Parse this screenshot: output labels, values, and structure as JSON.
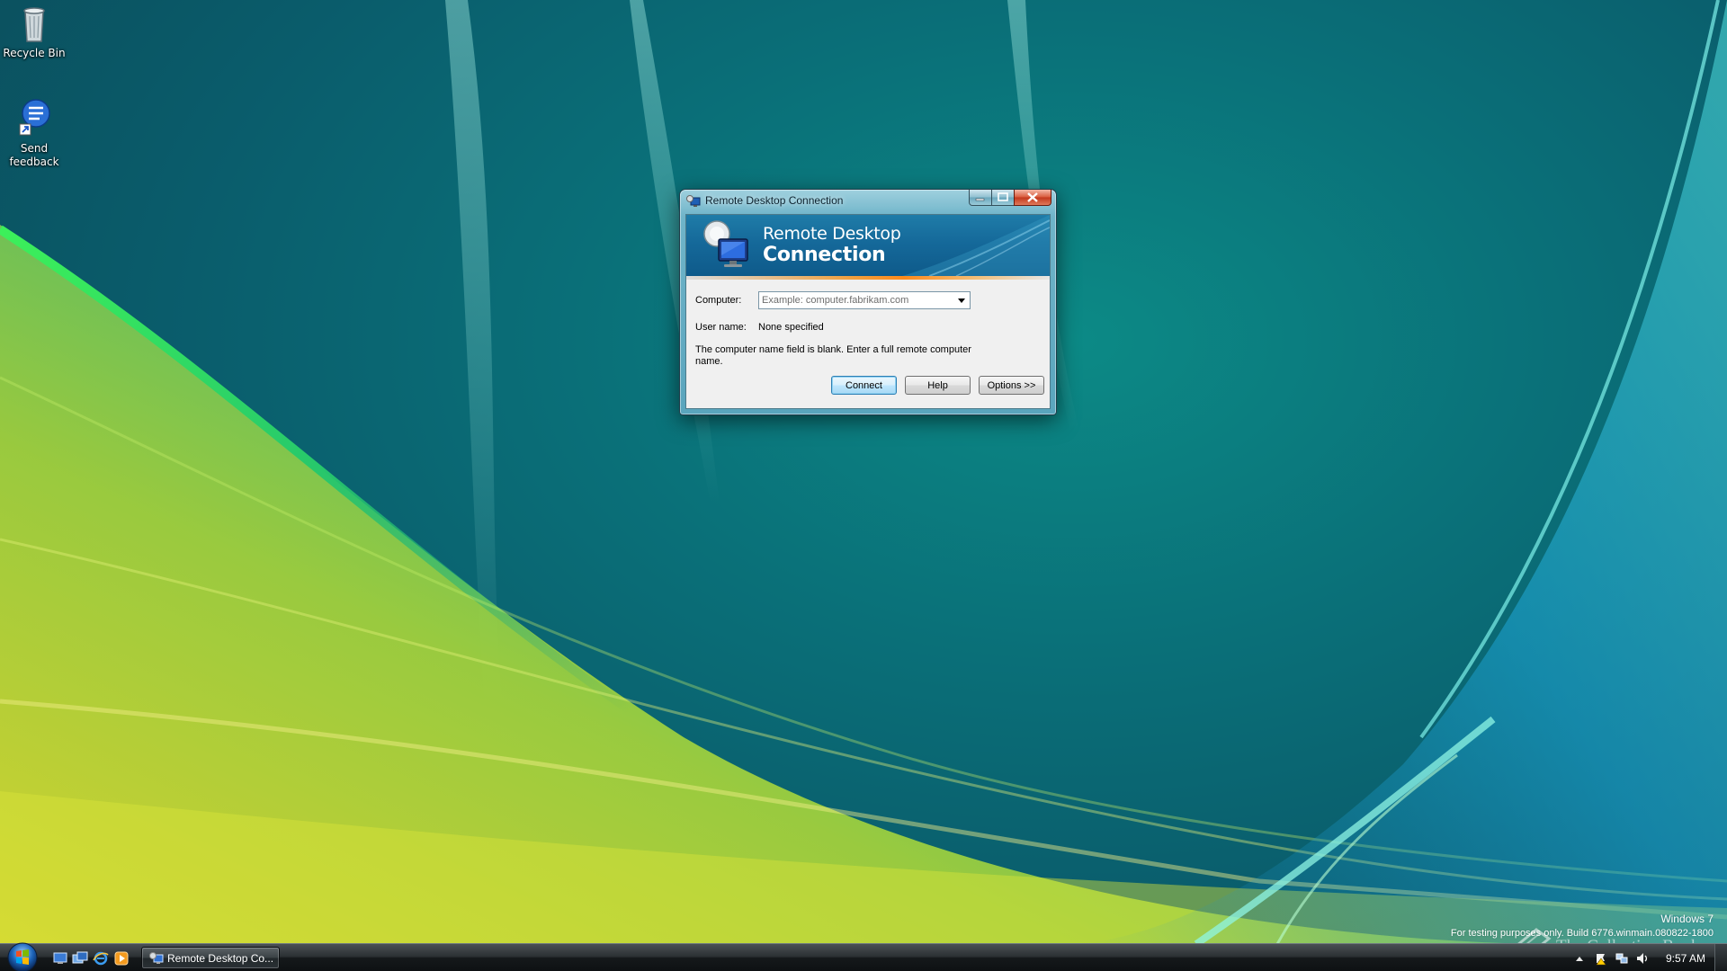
{
  "desktop": {
    "icons": [
      {
        "label": "Recycle Bin",
        "icon": "recycle-bin-icon"
      },
      {
        "label": "Send feedback",
        "icon": "feedback-icon"
      }
    ]
  },
  "dialog": {
    "title": "Remote Desktop Connection",
    "banner": {
      "line1": "Remote Desktop",
      "line2": "Connection"
    },
    "computer_label": "Computer:",
    "computer_value": "",
    "computer_placeholder": "Example: computer.fabrikam.com",
    "username_label": "User name:",
    "username_value": "None specified",
    "message": "The computer name field is blank. Enter a full remote computer name.",
    "buttons": {
      "connect": "Connect",
      "help": "Help",
      "options": "Options >>"
    }
  },
  "watermark": {
    "os": "Windows 7",
    "build": "For testing purposes only. Build 6776.winmain.080822-1800",
    "collection": "The Collection Book"
  },
  "taskbar": {
    "task_button_label": "Remote Desktop Co...",
    "clock": "9:57 AM"
  },
  "colors": {
    "accent": "#15699a",
    "banner_stripe": "#ff8a1a",
    "desktop_base": "#0a6f78"
  }
}
